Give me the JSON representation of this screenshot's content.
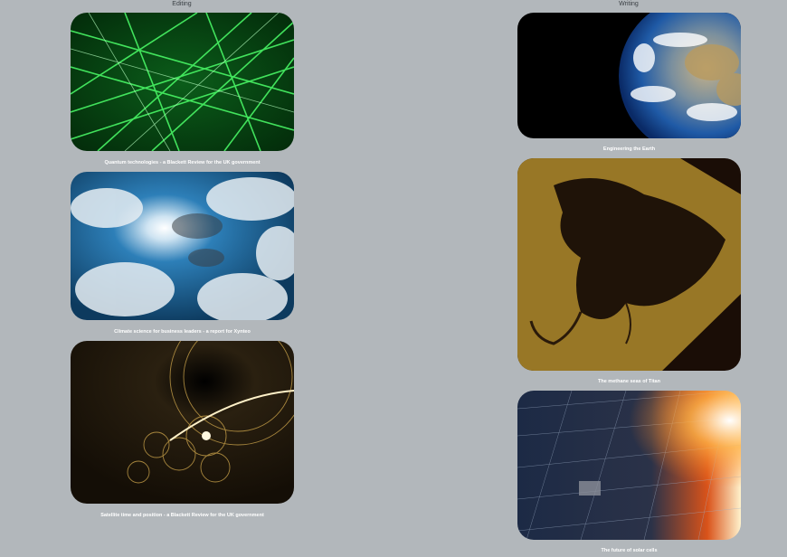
{
  "columns": {
    "editing": "Editing",
    "writing": "Writing"
  },
  "editing_items": [
    {
      "caption": "Quantum technologies - a Blackett Review for the UK government",
      "image": "green-laser-grid"
    },
    {
      "caption": "Climate science for business leaders - a report for Xynteo",
      "image": "blue-sky-clouds"
    },
    {
      "caption": "Satellite time and position - a Blackett Review for the UK government",
      "image": "golden-orbits"
    }
  ],
  "writing_items": [
    {
      "caption": "Engineering the Earth",
      "image": "earth-from-space"
    },
    {
      "caption": "The methane seas of Titan",
      "image": "titan-radar-map"
    },
    {
      "caption": "The future of solar cells",
      "image": "solar-panel-sunset"
    }
  ]
}
